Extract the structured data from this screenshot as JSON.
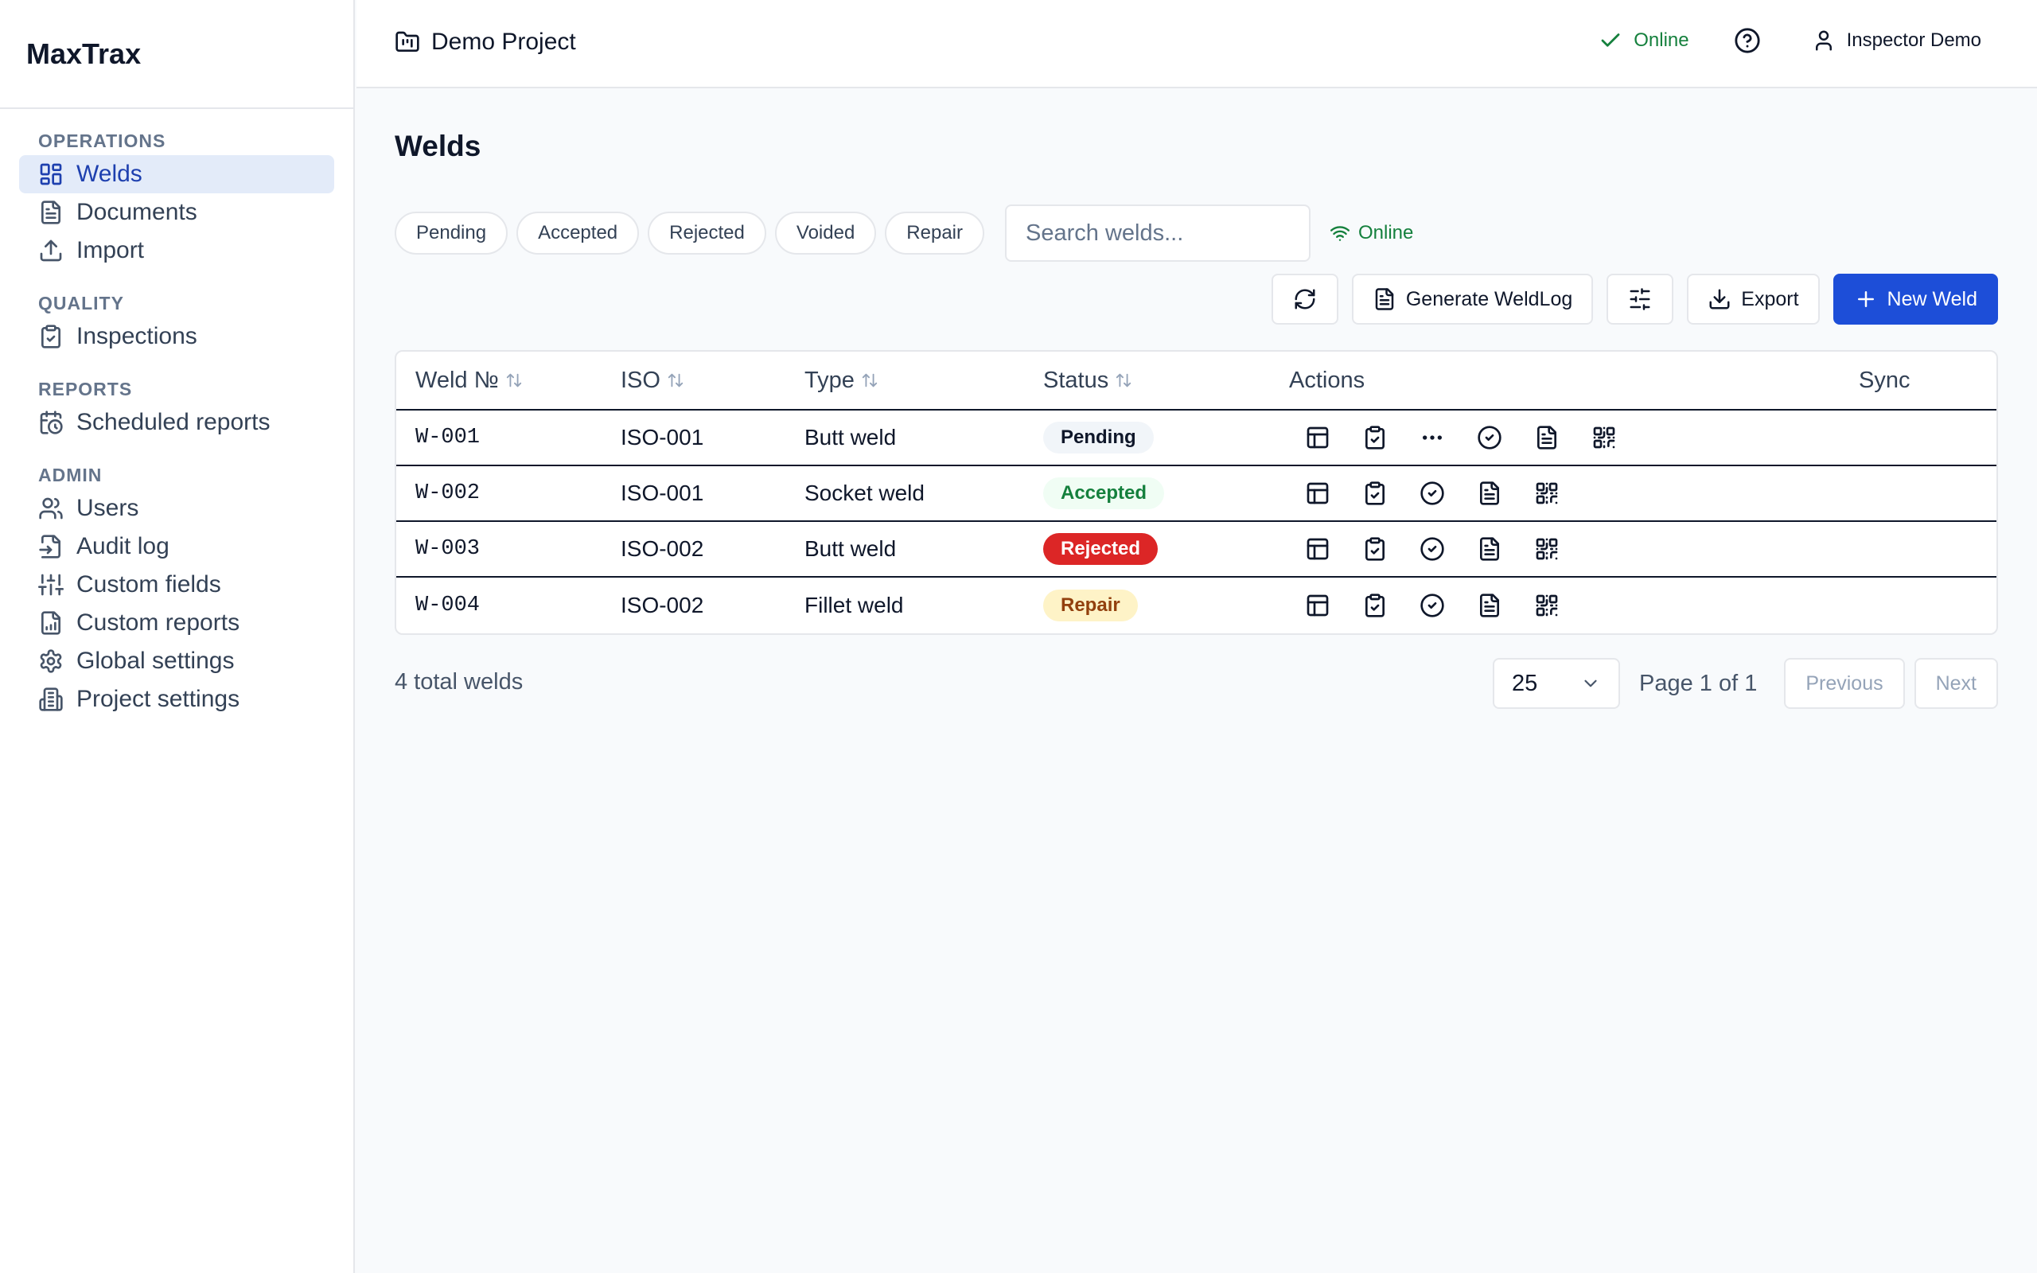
{
  "app": {
    "name": "MaxTrax"
  },
  "sidebar": {
    "sections": [
      {
        "title": "OPERATIONS",
        "items": [
          {
            "label": "Welds",
            "icon": "grid-icon",
            "active": true
          },
          {
            "label": "Documents",
            "icon": "document-icon"
          },
          {
            "label": "Import",
            "icon": "upload-icon"
          }
        ]
      },
      {
        "title": "QUALITY",
        "items": [
          {
            "label": "Inspections",
            "icon": "clipboard-check-icon"
          }
        ]
      },
      {
        "title": "REPORTS",
        "items": [
          {
            "label": "Scheduled reports",
            "icon": "calendar-clock-icon"
          }
        ]
      },
      {
        "title": "ADMIN",
        "items": [
          {
            "label": "Users",
            "icon": "users-icon"
          },
          {
            "label": "Audit log",
            "icon": "audit-log-icon"
          },
          {
            "label": "Custom fields",
            "icon": "sliders-icon"
          },
          {
            "label": "Custom reports",
            "icon": "report-file-icon"
          },
          {
            "label": "Global settings",
            "icon": "gear-icon"
          },
          {
            "label": "Project settings",
            "icon": "building-icon"
          }
        ]
      }
    ]
  },
  "header": {
    "project": "Demo Project",
    "status": "Online",
    "user": "Inspector Demo"
  },
  "page": {
    "title": "Welds",
    "filters": [
      "Pending",
      "Accepted",
      "Rejected",
      "Voided",
      "Repair"
    ],
    "search_placeholder": "Search welds...",
    "connection": "Online"
  },
  "toolbar": {
    "generate": "Generate WeldLog",
    "export": "Export",
    "new_weld": "New Weld"
  },
  "table": {
    "columns": [
      "Weld №",
      "ISO",
      "Type",
      "Status",
      "Actions",
      "Sync"
    ],
    "rows": [
      {
        "weld": "W-001",
        "iso": "ISO-001",
        "type": "Butt weld",
        "status": "Pending",
        "actions": [
          "table-icon",
          "clipboard-check-icon",
          "more-icon",
          "check-circle-icon",
          "document-icon",
          "qr-code-icon"
        ]
      },
      {
        "weld": "W-002",
        "iso": "ISO-001",
        "type": "Socket weld",
        "status": "Accepted",
        "actions": [
          "table-icon",
          "clipboard-check-icon",
          "check-circle-icon",
          "document-icon",
          "qr-code-icon"
        ]
      },
      {
        "weld": "W-003",
        "iso": "ISO-002",
        "type": "Butt weld",
        "status": "Rejected",
        "actions": [
          "table-icon",
          "clipboard-check-icon",
          "check-circle-icon",
          "document-icon",
          "qr-code-icon"
        ]
      },
      {
        "weld": "W-004",
        "iso": "ISO-002",
        "type": "Fillet weld",
        "status": "Repair",
        "actions": [
          "table-icon",
          "clipboard-check-icon",
          "check-circle-icon",
          "document-icon",
          "qr-code-icon"
        ]
      }
    ]
  },
  "footer": {
    "total": "4 total welds",
    "page_size": "25",
    "page_info": "Page 1 of 1",
    "previous": "Previous",
    "next": "Next"
  },
  "colors": {
    "accent": "#1d4ed8",
    "online": "#15803d",
    "rejected": "#dc2626",
    "repair_bg": "#fef3c7",
    "accepted_bg": "#f0fdf4"
  }
}
